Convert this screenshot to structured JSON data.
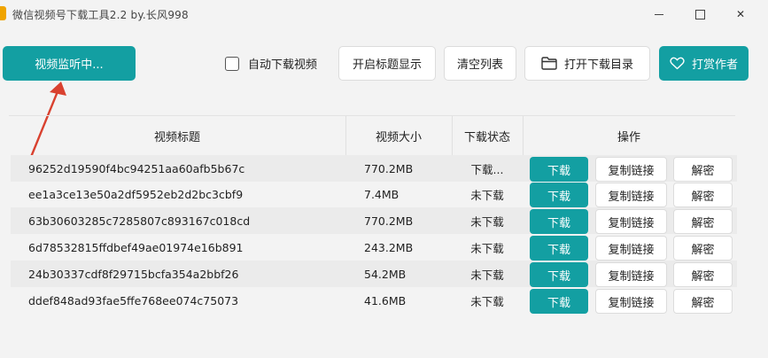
{
  "window": {
    "title": "微信视频号下载工具2.2 by.长风998",
    "close_glyph": "✕"
  },
  "toolbar": {
    "monitor_label": "视频监听中...",
    "auto_download_label": "自动下载视频",
    "show_title_label": "开启标题显示",
    "clear_list_label": "清空列表",
    "open_dir_label": "打开下载目录",
    "donate_label": "打赏作者"
  },
  "colors": {
    "accent": "#139fa2",
    "arrow": "#d9412f"
  },
  "table": {
    "headers": {
      "title": "视频标题",
      "size": "视频大小",
      "status": "下载状态",
      "ops": "操作"
    },
    "action_labels": {
      "download": "下载",
      "copy": "复制链接",
      "decrypt": "解密"
    },
    "rows": [
      {
        "title": "96252d19590f4bc94251aa60afb5b67c",
        "size": "770.2MB",
        "status": "下载..."
      },
      {
        "title": "ee1a3ce13e50a2df5952eb2d2bc3cbf9",
        "size": "7.4MB",
        "status": "未下载"
      },
      {
        "title": "63b30603285c7285807c893167c018cd",
        "size": "770.2MB",
        "status": "未下载"
      },
      {
        "title": "6d78532815ffdbef49ae01974e16b891",
        "size": "243.2MB",
        "status": "未下载"
      },
      {
        "title": "24b30337cdf8f29715bcfa354a2bbf26",
        "size": "54.2MB",
        "status": "未下载"
      },
      {
        "title": "ddef848ad93fae5ffe768ee074c75073",
        "size": "41.6MB",
        "status": "未下载"
      }
    ]
  }
}
